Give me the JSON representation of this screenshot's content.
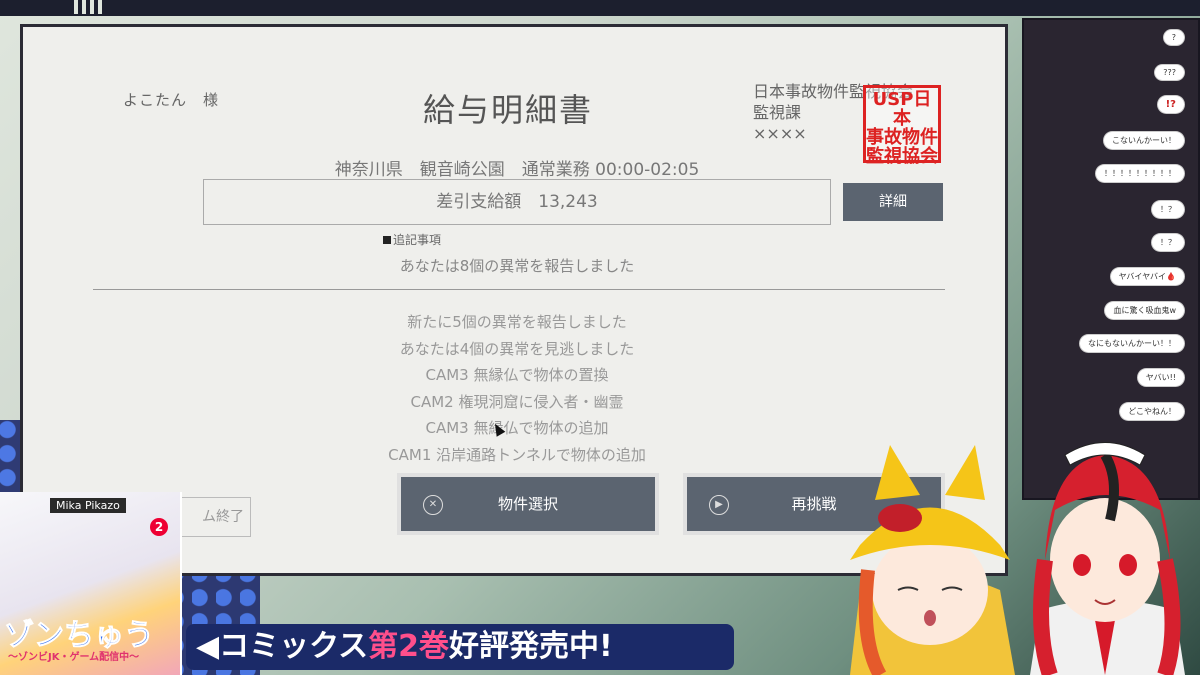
{
  "header": {
    "recipient": "よこたん　様",
    "title": "給与明細書",
    "issuer_org": "日本事故物件監視協会",
    "issuer_dept": "監視課",
    "issuer_name": "××××",
    "seal_lines": [
      "USP日本",
      "事故物件",
      "監視協会"
    ]
  },
  "summary": {
    "location": "神奈川県　観音崎公園　通常業務 00:00-02:05",
    "pay_label": "差引支給額　13,243",
    "detail_button": "詳細",
    "note_label": "追記事項",
    "note_text": "あなたは8個の異常を報告しました"
  },
  "log": [
    "新たに5個の異常を報告しました",
    "あなたは4個の異常を見逃しました",
    "CAM3 無縁仏で物体の置換",
    "CAM2 権現洞窟に侵入者・幽霊",
    "CAM3 無縁仏で物体の追加",
    "CAM1 沿岸通路トンネルで物体の追加"
  ],
  "buttons": {
    "end": "ム終了",
    "select": "物件選択",
    "retry": "再挑戦"
  },
  "chat": [
    {
      "text": "?",
      "color": "normal"
    },
    {
      "text": "???",
      "color": "normal"
    },
    {
      "text": "!?",
      "color": "red"
    },
    {
      "text": "こないんかーい！",
      "color": "normal"
    },
    {
      "text": "！！！！！！！！！",
      "color": "normal"
    },
    {
      "text": "！？",
      "color": "normal"
    },
    {
      "text": "！？",
      "color": "normal"
    },
    {
      "text": "ヤバイヤバイ🩸",
      "color": "normal"
    },
    {
      "text": "血に驚く吸血鬼w",
      "color": "normal"
    },
    {
      "text": "なにもないんかーい！！",
      "color": "normal"
    },
    {
      "text": "ヤバい!!",
      "color": "normal"
    },
    {
      "text": "どこやねん！",
      "color": "normal"
    }
  ],
  "promo": {
    "author": "Mika Pikazo",
    "volume": "2",
    "logo": "ゾンちゅう",
    "logo_sub": "〜ゾンビJK・ゲーム配信中〜",
    "banner_pre": "◀コミックス",
    "banner_hl": "第2巻",
    "banner_post": "好評発売中!"
  },
  "colors": {
    "window_bg": "#efefec",
    "button_bg": "#5b6470",
    "seal_red": "#dd2222"
  }
}
